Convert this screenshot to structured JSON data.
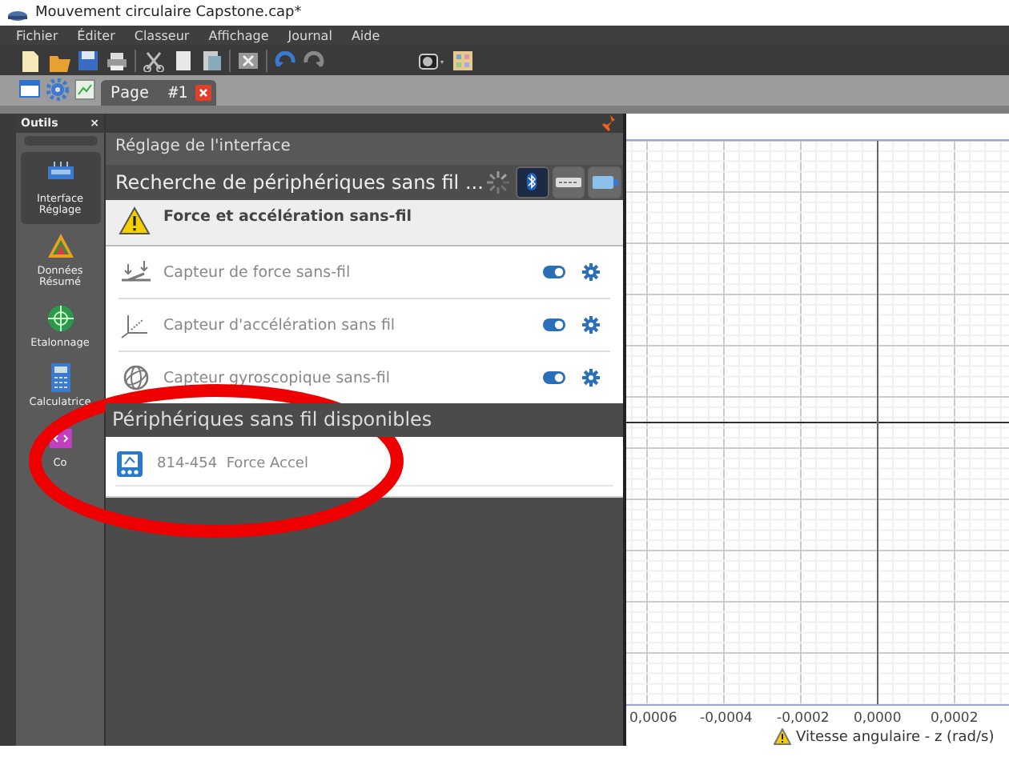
{
  "window": {
    "title": "Mouvement circulaire Capstone.cap*"
  },
  "menu": [
    "Fichier",
    "Éditer",
    "Classeur",
    "Affichage",
    "Journal",
    "Aide"
  ],
  "page_tabs": [
    {
      "label": "Page  #1",
      "selected": true
    }
  ],
  "tools": {
    "title": "Outils",
    "close": "×",
    "items": [
      {
        "kind": "interface",
        "label": "Interface Réglage",
        "selected": true
      },
      {
        "kind": "data",
        "label": "Données Résumé",
        "selected": false
      },
      {
        "kind": "calibration",
        "label": "Etalonnage",
        "selected": false
      },
      {
        "kind": "calculator",
        "label": "Calculatrice",
        "selected": false
      },
      {
        "kind": "code",
        "label": "Co",
        "selected": false
      }
    ]
  },
  "panel": {
    "title": "Réglage de l'interface",
    "search_status": "Recherche de périphériques sans fil ...",
    "connections": [
      {
        "kind": "bluetooth",
        "selected": true
      },
      {
        "kind": "cable",
        "selected": false
      },
      {
        "kind": "usb",
        "selected": false
      }
    ],
    "device": {
      "name": "Force et accélération sans-fil",
      "warning": true
    },
    "sensors": [
      {
        "kind": "force",
        "label": "Capteur de force sans-fil",
        "on": true
      },
      {
        "kind": "acceleration",
        "label": "Capteur d'accélération sans fil",
        "on": true
      },
      {
        "kind": "gyroscope",
        "label": "Capteur gyroscopique sans-fil",
        "on": true
      }
    ],
    "available_title": "Périphériques sans fil disponibles",
    "available": [
      {
        "id": "814-454",
        "name": "Force Accel"
      }
    ]
  },
  "graph": {
    "x_ticks": [
      "0,0006",
      "-0,0004",
      "-0,0002",
      "0,0000",
      "0,0002"
    ],
    "x_title": "Vitesse angulaire - z (rad/s)",
    "x_title_warning": true
  }
}
